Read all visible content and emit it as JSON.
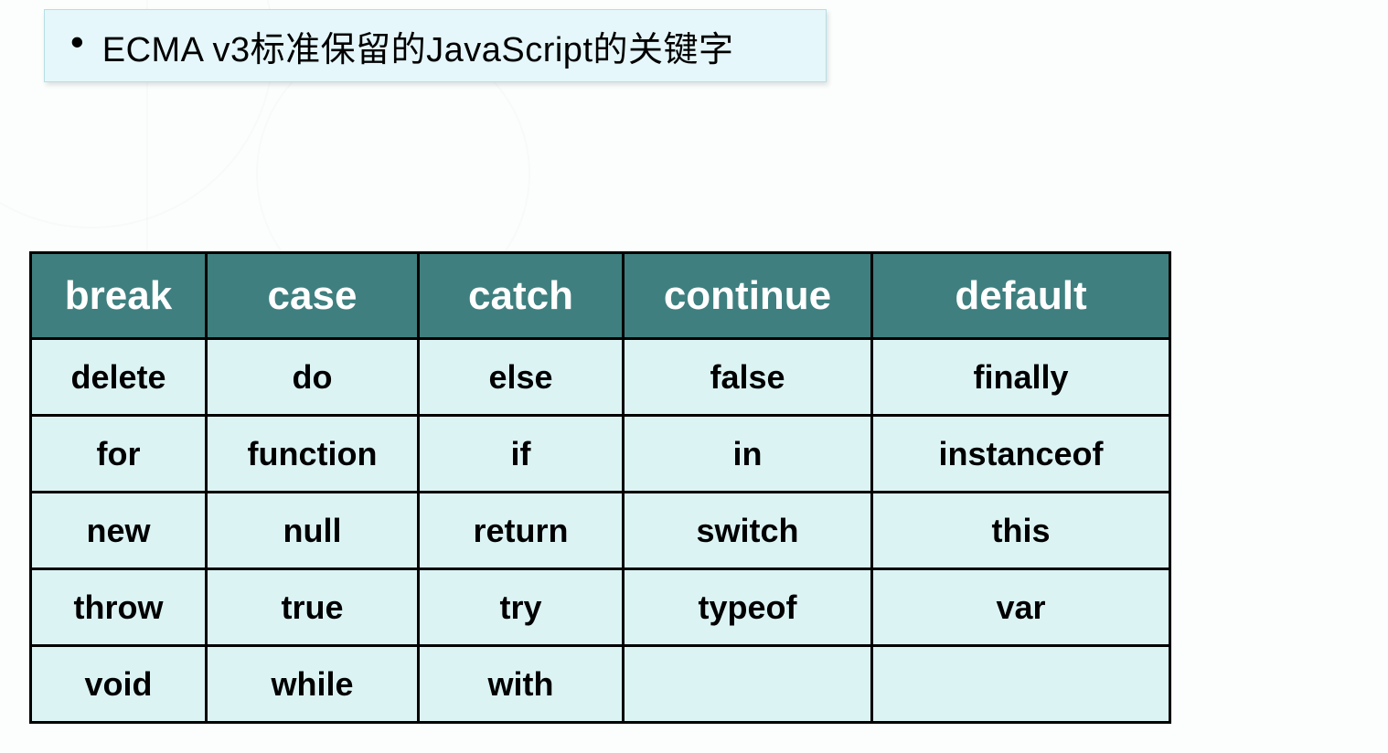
{
  "heading": "ECMA v3标准保留的JavaScript的关键字",
  "table": {
    "header": [
      "break",
      "case",
      "catch",
      "continue",
      "default"
    ],
    "rows": [
      [
        "delete",
        "do",
        "else",
        "false",
        "finally"
      ],
      [
        "for",
        "function",
        "if",
        "in",
        "instanceof"
      ],
      [
        "new",
        "null",
        "return",
        "switch",
        "this"
      ],
      [
        "throw",
        "true",
        "try",
        "typeof",
        "var"
      ],
      [
        "void",
        "while",
        "with",
        "",
        ""
      ]
    ]
  }
}
